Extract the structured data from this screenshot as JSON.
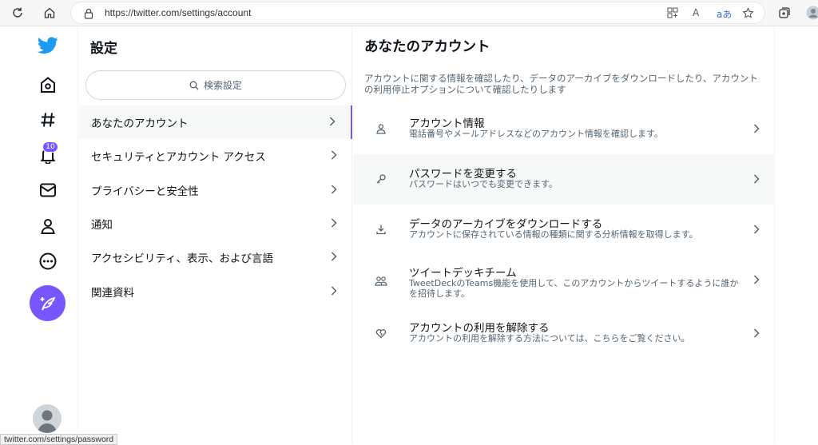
{
  "browser": {
    "url": "https://twitter.com/settings/account",
    "reader_label": "A",
    "translate_label": "aあ"
  },
  "nav": {
    "notification_count": "10",
    "items": [
      "home-icon",
      "explore-icon",
      "notifications-icon",
      "messages-icon",
      "profile-icon",
      "more-icon"
    ],
    "accent": "#7856ff",
    "logo_color": "#1d9bf0"
  },
  "settings": {
    "title": "設定",
    "search_placeholder": "検索設定",
    "items": [
      {
        "label": "あなたのアカウント"
      },
      {
        "label": "セキュリティとアカウント アクセス"
      },
      {
        "label": "プライバシーと安全性"
      },
      {
        "label": "通知"
      },
      {
        "label": "アクセシビリティ、表示、および言語"
      },
      {
        "label": "関連資料"
      }
    ]
  },
  "account": {
    "title": "あなたのアカウント",
    "description": "アカウントに関する情報を確認したり、データのアーカイブをダウンロードしたり、アカウントの利用停止オプションについて確認したりします",
    "items": [
      {
        "title": "アカウント情報",
        "subtitle": "電話番号やメールアドレスなどのアカウント情報を確認します。",
        "icon": "person-icon"
      },
      {
        "title": "パスワードを変更する",
        "subtitle": "パスワードはいつでも変更できます。",
        "icon": "key-icon"
      },
      {
        "title": "データのアーカイブをダウンロードする",
        "subtitle": "アカウントに保存されている情報の種類に関する分析情報を取得します。",
        "icon": "download-icon"
      },
      {
        "title": "ツイートデッキチーム",
        "subtitle": "TweetDeckのTeams機能を使用して、このアカウントからツイートするように誰かを招待します。",
        "icon": "team-icon"
      },
      {
        "title": "アカウントの利用を解除する",
        "subtitle": "アカウントの利用を解除する方法については、こちらをご覧ください。",
        "icon": "broken-heart-icon"
      }
    ]
  },
  "status_bar": {
    "text": "twitter.com/settings/password"
  }
}
